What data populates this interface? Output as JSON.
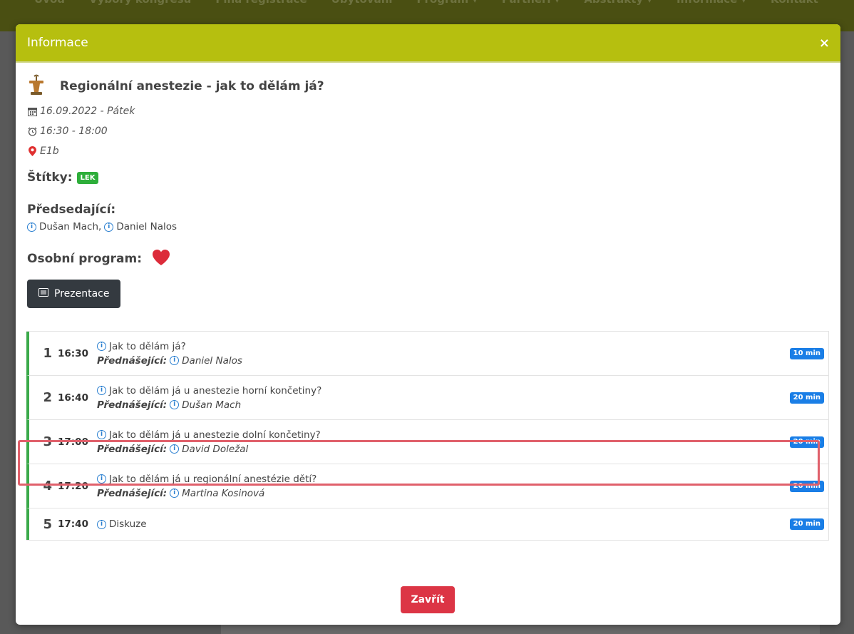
{
  "background_nav": [
    "Úvod",
    "Výbory kongresu",
    "Plná registrace",
    "Ubytování",
    "Program ▾",
    "Partneři ▾",
    "Abstrakty ▾",
    "Informace ▾",
    "Kontakt"
  ],
  "modal": {
    "header_title": "Informace",
    "close_icon": "×",
    "session_title": "Regionální anestezie - jak to dělám já?",
    "date": "16.09.2022 - Pátek",
    "time": "16:30 - 18:00",
    "room": "E1b",
    "tags_label": "Štítky:",
    "tag": "LEK",
    "chairs_label": "Předsedající:",
    "chairs": [
      "Dušan Mach",
      "Daniel Nalos"
    ],
    "chairs_separator": ",",
    "personal_program_label": "Osobní program:",
    "prezentace_button": "Prezentace",
    "close_button": "Zavřít",
    "speaker_label": "Přednášející:",
    "program": [
      {
        "num": "1",
        "time": "16:30",
        "title": "Jak to dělám já?",
        "speaker": "Daniel Nalos",
        "duration": "10 min"
      },
      {
        "num": "2",
        "time": "16:40",
        "title": "Jak to dělám já u anestezie horní končetiny?",
        "speaker": "Dušan Mach",
        "duration": "20 min"
      },
      {
        "num": "3",
        "time": "17:00",
        "title": "Jak to dělám já u anestezie dolní končetiny?",
        "speaker": "David Doležal",
        "duration": "20 min"
      },
      {
        "num": "4",
        "time": "17:20",
        "title": "Jak to dělám já u regionální anestézie dětí?",
        "speaker": "Martina Kosinová",
        "duration": "20 min"
      },
      {
        "num": "5",
        "time": "17:40",
        "title": "Diskuze",
        "speaker": "",
        "duration": "20 min"
      }
    ]
  },
  "colors": {
    "header": "#b6bf0f",
    "tag_green": "#2eae3a",
    "duration_blue": "#1a7ee6",
    "close_red": "#dc3545",
    "highlight": "#e0606b"
  }
}
